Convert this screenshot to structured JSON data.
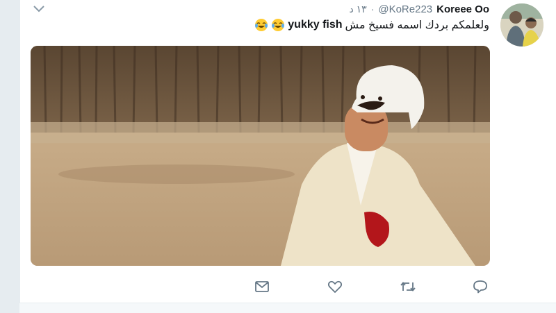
{
  "tweet": {
    "display_name": "Koreee Oo",
    "handle": "@KoRe223",
    "separator": "·",
    "time": "١٣ د",
    "text_arabic": "ولعلمكم بردك اسمه فسيخ مش",
    "text_english": "yukky fish",
    "emoji": [
      "face-with-tears-of-joy",
      "face-with-tears-of-joy"
    ]
  },
  "media": {
    "type": "photo"
  },
  "actions": [
    "reply-icon",
    "retweet-icon",
    "like-icon",
    "direct-message-icon"
  ],
  "colors": {
    "secondary_text": "#657786",
    "primary_text": "#14171a",
    "background": "#e6ecf0"
  }
}
